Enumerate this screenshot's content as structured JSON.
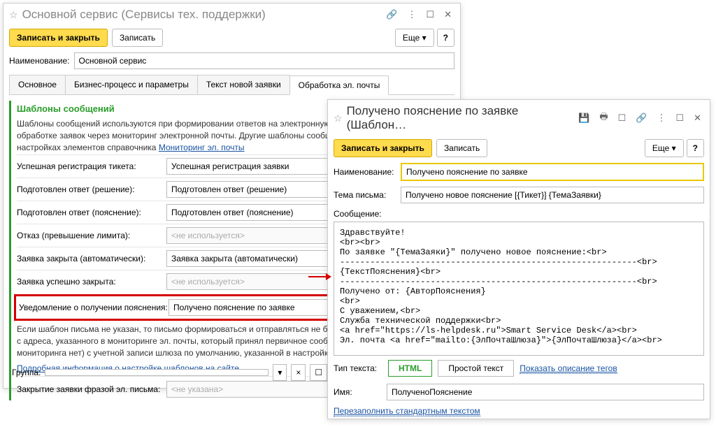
{
  "main": {
    "title": "Основной сервис (Сервисы тех. поддержки)",
    "save_close": "Записать и закрыть",
    "save": "Записать",
    "more": "Еще",
    "help": "?",
    "name_label": "Наименование:",
    "name_value": "Основной сервис",
    "tabs": [
      "Основное",
      "Бизнес-процесс и параметры",
      "Текст новой заявки",
      "Обработка эл. почты"
    ],
    "section_title": "Шаблоны сообщений",
    "help1": "Шаблоны сообщений используются при формировании ответов на электронную почту клиента в рамках обработке заявок через мониторинг электронной почты. Другие шаблоны сообщений можно отредактировать в настройках элементов справочника ",
    "help1_link": "Мониторинг эл. почты",
    "templates": [
      {
        "label": "Успешная регистрация тикета:",
        "value": "Успешная регистрация заявки"
      },
      {
        "label": "Подготовлен ответ (решение):",
        "value": "Подготовлен ответ (решение)"
      },
      {
        "label": "Подготовлен ответ (пояснение):",
        "value": "Подготовлен ответ (пояснение)"
      },
      {
        "label": "Отказ (превышение лимита):",
        "value": "<не используется>",
        "ph": true
      },
      {
        "label": "Заявка закрыта (автоматически):",
        "value": "Заявка закрыта (автоматически)"
      },
      {
        "label": "Заявка успешно закрыта:",
        "value": "<не используется>",
        "ph": true
      },
      {
        "label": "Уведомление о получении пояснения:",
        "value": "Получено пояснение по заявке",
        "hl": true
      }
    ],
    "help2": "Если шаблон письма не указан, то письмо формироваться и отправляться не будет. Отправка осуществляется с адреса, указанного в мониторинге эл. почты, который принял первичное сообщение, либо (если такого мониторинга нет) с учетной записи шлюза по умолчанию, указанной в настройках.",
    "help3_link": "Подробная информация о настройке шаблонов на сайте",
    "close_phrase_label": "Закрытие заявки фразой эл. письма:",
    "close_phrase_value": "<не указана>",
    "group_label": "Группа:"
  },
  "tpl": {
    "title": "Получено пояснение по заявке (Шаблон…",
    "save_close": "Записать и закрыть",
    "save": "Записать",
    "more": "Еще",
    "help": "?",
    "name_label": "Наименование:",
    "name_value": "Получено пояснение по заявке",
    "subject_label": "Тема письма:",
    "subject_value": "Получено новое пояснение [{Тикет}] {ТемаЗаявки}",
    "msg_label": "Сообщение:",
    "msg_body": "Здравствуйте!\n<br><br>\nПо заявке \"{ТемаЗаяки}\" получено новое пояснение:<br>\n-----------------------------------------------------------<br>\n{ТекстПояснения}<br>\n-----------------------------------------------------------<br>\nПолучено от: {АвторПояснения}\n<br>\nС уважением,<br>\nСлужба технической поддержки<br>\n<a href=\"https://ls-helpdesk.ru\">Smart Service Desk</a><br>\nЭл. почта <a href=\"mailto:{ЭлПочтаШлюза}\">{ЭлПочтаШлюза}</a><br>",
    "type_label": "Тип текста:",
    "type_html": "HTML",
    "type_plain": "Простой текст",
    "show_tags": "Показать описание тегов",
    "id_label": "Имя:",
    "id_value": "ПолученоПояснение",
    "refill": "Перезаполнить стандартным текстом"
  }
}
